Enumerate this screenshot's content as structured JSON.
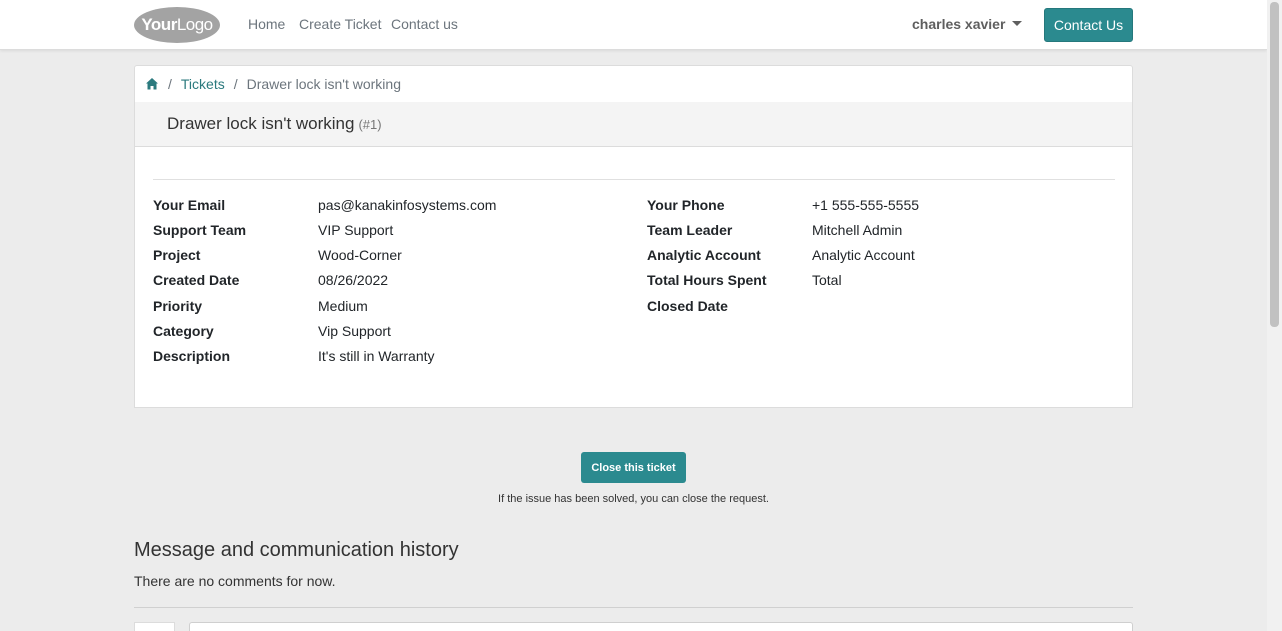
{
  "navbar": {
    "logo_bold": "Your",
    "logo_light": "Logo",
    "links": [
      "Home",
      "Create Ticket",
      "Contact us"
    ],
    "user_name": "charles xavier",
    "contact_button": "Contact Us",
    "accent_color": "#2b8a8f"
  },
  "breadcrumb": {
    "home_icon": "home-icon",
    "items": [
      "Tickets",
      "Drawer lock isn't working"
    ]
  },
  "ticket": {
    "title": "Drawer lock isn't working",
    "number": "(#1)",
    "left_fields": [
      {
        "label": "Your Email",
        "value": "pas@kanakinfosystems.com"
      },
      {
        "label": "Support Team",
        "value": "VIP Support"
      },
      {
        "label": "Project",
        "value": "Wood-Corner"
      },
      {
        "label": "Created Date",
        "value": "08/26/2022"
      },
      {
        "label": "Priority",
        "value": "Medium"
      },
      {
        "label": "Category",
        "value": "Vip Support"
      },
      {
        "label": "Description",
        "value": "It's still in Warranty"
      }
    ],
    "right_fields": [
      {
        "label": "Your Phone",
        "value": "+1 555-555-5555"
      },
      {
        "label": "Team Leader",
        "value": "Mitchell Admin"
      },
      {
        "label": "Analytic Account",
        "value": "Analytic Account"
      },
      {
        "label": "Total Hours Spent",
        "value": "Total"
      },
      {
        "label": "Closed Date",
        "value": ""
      }
    ]
  },
  "actions": {
    "close_button": "Close this ticket",
    "close_hint": "If the issue has been solved, you can close the request."
  },
  "history": {
    "title": "Message and communication history",
    "empty_text": "There are no comments for now."
  }
}
